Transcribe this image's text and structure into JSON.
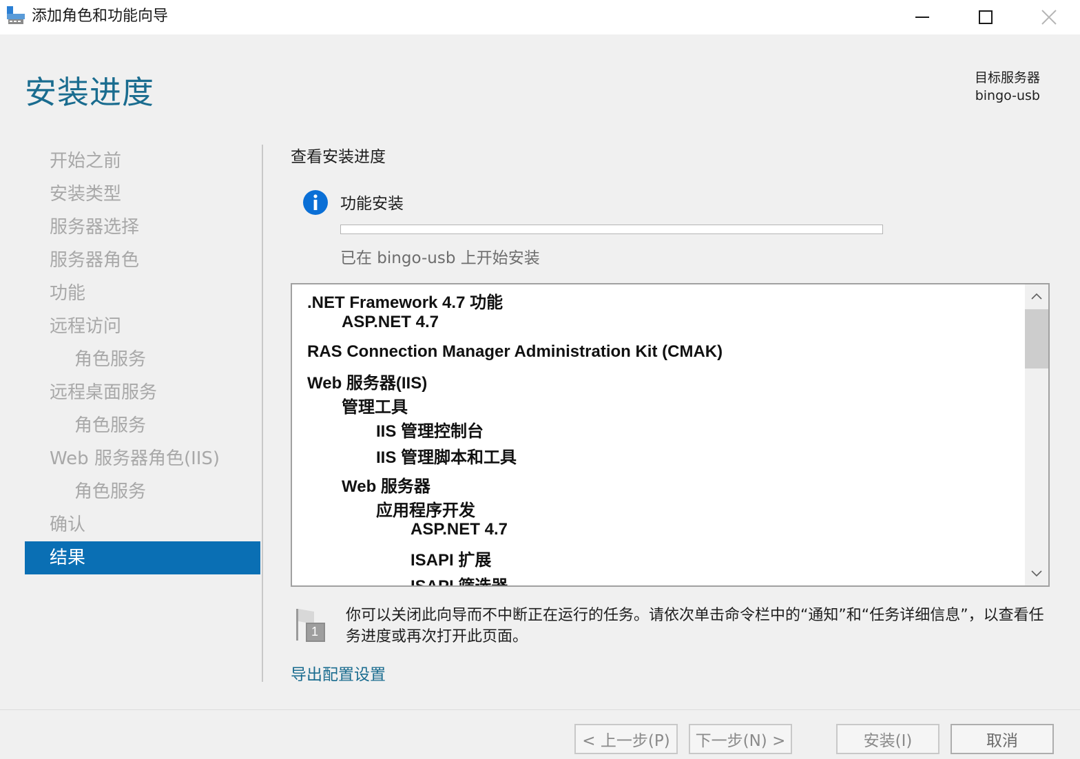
{
  "window": {
    "title": "添加角色和功能向导"
  },
  "header": {
    "page_title": "安装进度",
    "destination_label": "目标服务器",
    "destination_server": "bingo-usb"
  },
  "nav": {
    "items": [
      {
        "label": "开始之前",
        "level": 0,
        "active": false
      },
      {
        "label": "安装类型",
        "level": 0,
        "active": false
      },
      {
        "label": "服务器选择",
        "level": 0,
        "active": false
      },
      {
        "label": "服务器角色",
        "level": 0,
        "active": false
      },
      {
        "label": "功能",
        "level": 0,
        "active": false
      },
      {
        "label": "远程访问",
        "level": 0,
        "active": false
      },
      {
        "label": "角色服务",
        "level": 1,
        "active": false
      },
      {
        "label": "远程桌面服务",
        "level": 0,
        "active": false
      },
      {
        "label": "角色服务",
        "level": 1,
        "active": false
      },
      {
        "label": "Web 服务器角色(IIS)",
        "level": 0,
        "active": false
      },
      {
        "label": "角色服务",
        "level": 1,
        "active": false
      },
      {
        "label": "确认",
        "level": 0,
        "active": false
      },
      {
        "label": "结果",
        "level": 0,
        "active": true
      }
    ]
  },
  "content": {
    "title": "查看安装进度",
    "feature_title": "功能安装",
    "progress": 0,
    "status": "已在 bingo-usb 上开始安装",
    "list": [
      ".NET Framework 4.7 功能",
      "ASP.NET 4.7",
      "RAS Connection Manager Administration Kit (CMAK)",
      "Web 服务器(IIS)",
      "管理工具",
      "IIS 管理控制台",
      "IIS 管理脚本和工具",
      "Web 服务器",
      "应用程序开发",
      "ASP.NET 4.7",
      "ISAPI 扩展",
      "ISAPI 筛选器"
    ],
    "note": "你可以关闭此向导而不中断正在运行的任务。请依次单击命令栏中的“通知”和“任务详细信息”，以查看任务进度或再次打开此页面。",
    "note_badge": "1",
    "export_link": "导出配置设置"
  },
  "footer": {
    "prev_label": "< 上一步(P)",
    "next_label": "下一步(N) >",
    "install_label": "安装(I)",
    "cancel_label": "取消"
  },
  "colors": {
    "accent": "#1a6c8f",
    "nav_active": "#0a6fb4",
    "info_blue": "#0a6fd6"
  },
  "icons": {
    "app": "server-manager-icon",
    "info": "info-icon",
    "note": "flag-notification-icon"
  }
}
